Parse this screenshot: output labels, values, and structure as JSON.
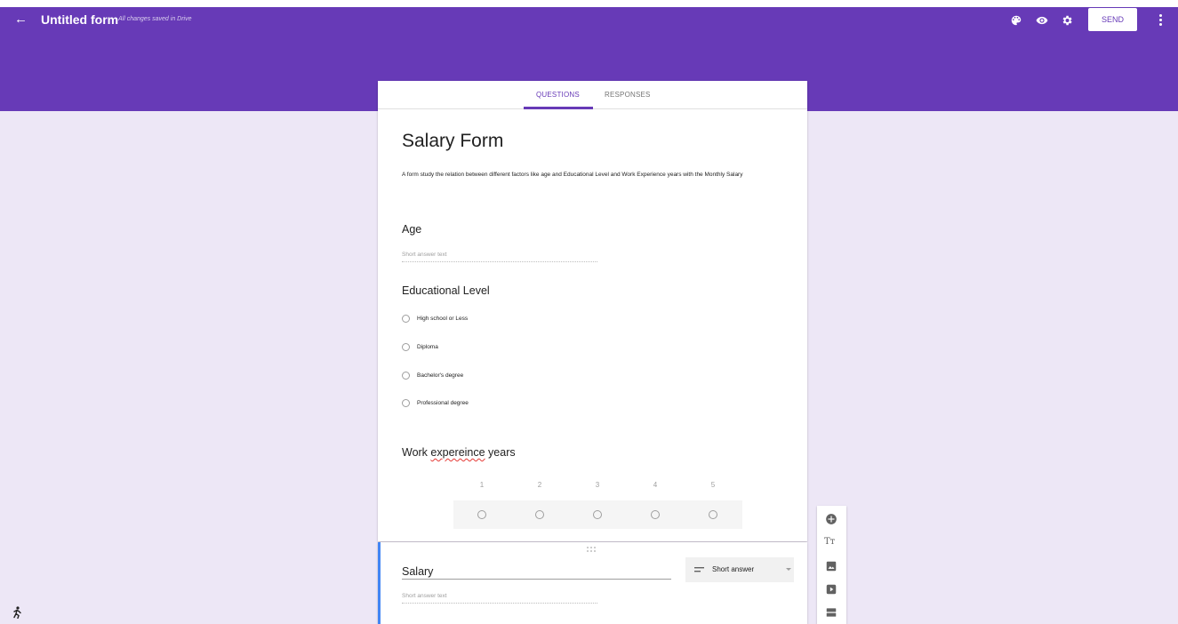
{
  "header": {
    "back_label": "←",
    "form_title": "Untitled form",
    "save_status": "All changes saved in Drive",
    "send_label": "SEND",
    "icons": [
      "palette-icon",
      "preview-eye-icon",
      "settings-gear-icon",
      "more-vert-icon"
    ],
    "bg_color": "#673ab7"
  },
  "tabs": {
    "questions": "QUESTIONS",
    "responses": "RESPONSES",
    "active": "questions"
  },
  "form": {
    "title": "Salary Form",
    "description": "A form study the relation between different factors like age and Educational Level and Work Experience years with the Monthly Salary"
  },
  "questions": {
    "age": {
      "label": "Age",
      "placeholder": "Short answer text"
    },
    "education": {
      "label": "Educational Level",
      "options": [
        "High school or Less",
        "Diploma",
        "Bachelor's degree",
        "Professional degree"
      ]
    },
    "experience": {
      "label_pre": "Work ",
      "label_misspelled": "expereince",
      "label_post": " years",
      "scale": [
        "1",
        "2",
        "3",
        "4",
        "5"
      ]
    },
    "salary": {
      "label": "Salary",
      "placeholder": "Short answer text",
      "type_label": "Short answer"
    }
  },
  "side_toolbar": {
    "icons": [
      "add-question-icon",
      "add-title-text-icon",
      "add-image-icon",
      "add-video-icon",
      "add-section-icon"
    ],
    "title_glyph": "Tт"
  },
  "colors": {
    "accent": "#673ab7",
    "page_bg": "#ede7f6",
    "active_question_bar": "#4285f4"
  }
}
